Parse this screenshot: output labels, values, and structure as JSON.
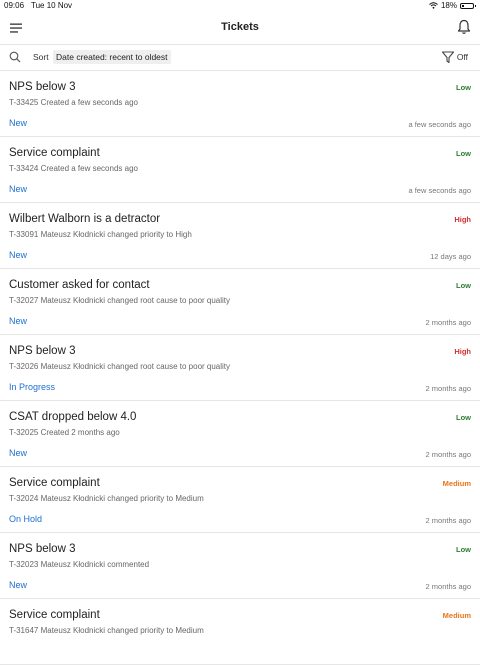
{
  "status_bar": {
    "time": "09:06",
    "date": "Tue 10 Nov",
    "battery": "18%"
  },
  "header": {
    "title": "Tickets"
  },
  "toolbar": {
    "sort_label": "Sort",
    "sort_value": "Date created: recent to oldest",
    "filter_state": "Off"
  },
  "colors": {
    "low": "#2e7d32",
    "high": "#d32f2f",
    "medium": "#e6761b",
    "status": "#1f6fd1"
  },
  "tickets": [
    {
      "title": "NPS below 3",
      "subtitle": "T-33425 Created a few seconds ago",
      "status": "New",
      "priority": "Low",
      "time": "a few seconds ago"
    },
    {
      "title": "Service complaint",
      "subtitle": "T-33424 Created a few seconds ago",
      "status": "New",
      "priority": "Low",
      "time": "a few seconds ago"
    },
    {
      "title": "Wilbert Walborn is a detractor",
      "subtitle": "T-33091 Mateusz Kłodnicki changed priority to High",
      "status": "New",
      "priority": "High",
      "time": "12 days ago"
    },
    {
      "title": "Customer asked for contact",
      "subtitle": "T-32027 Mateusz Kłodnicki changed root cause to poor quality",
      "status": "New",
      "priority": "Low",
      "time": "2 months ago"
    },
    {
      "title": "NPS below 3",
      "subtitle": "T-32026 Mateusz Kłodnicki changed root cause to poor quality",
      "status": "In Progress",
      "priority": "High",
      "time": "2 months ago"
    },
    {
      "title": "CSAT dropped below 4.0",
      "subtitle": "T-32025 Created 2 months ago",
      "status": "New",
      "priority": "Low",
      "time": "2 months ago"
    },
    {
      "title": "Service complaint",
      "subtitle": "T-32024 Mateusz Kłodnicki changed priority to Medium",
      "status": "On Hold",
      "priority": "Medium",
      "time": "2 months ago"
    },
    {
      "title": "NPS below 3",
      "subtitle": "T-32023 Mateusz Kłodnicki commented",
      "status": "New",
      "priority": "Low",
      "time": "2 months ago"
    },
    {
      "title": "Service complaint",
      "subtitle": "T-31647 Mateusz Kłodnicki changed priority to Medium",
      "status": "",
      "priority": "Medium",
      "time": ""
    }
  ]
}
